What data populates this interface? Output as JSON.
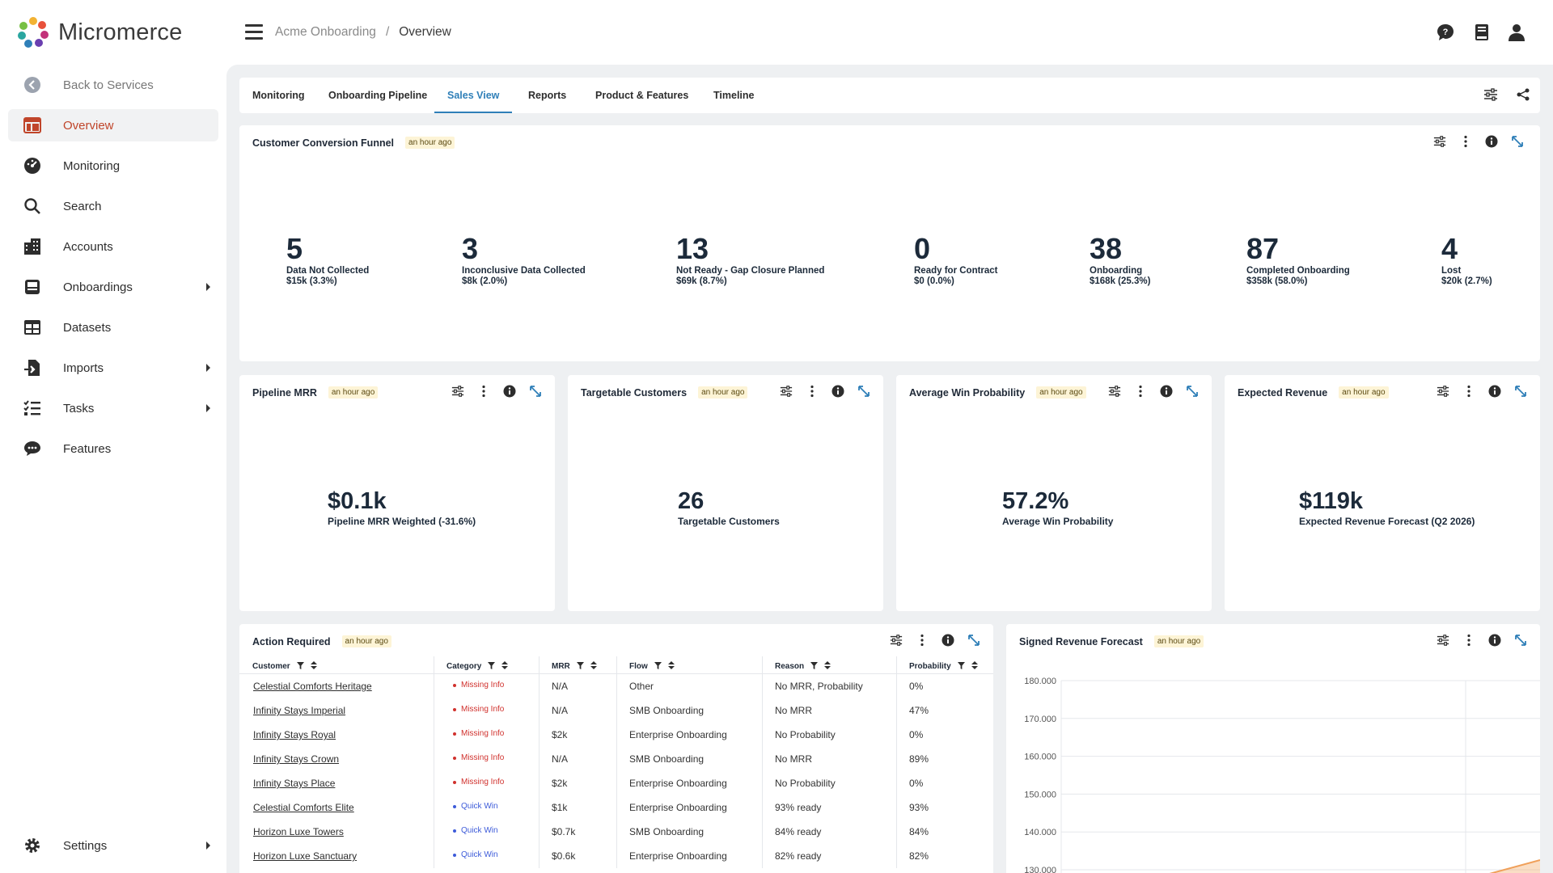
{
  "brand": {
    "name": "Micromerce"
  },
  "sidebar": {
    "items": [
      {
        "label": "Back to Services"
      },
      {
        "label": "Overview"
      },
      {
        "label": "Monitoring"
      },
      {
        "label": "Search"
      },
      {
        "label": "Accounts"
      },
      {
        "label": "Onboardings"
      },
      {
        "label": "Datasets"
      },
      {
        "label": "Imports"
      },
      {
        "label": "Tasks"
      },
      {
        "label": "Features"
      }
    ],
    "settings": {
      "label": "Settings"
    }
  },
  "breadcrumb": {
    "parent": "Acme Onboarding",
    "separator": "/",
    "current": "Overview"
  },
  "tabs": [
    {
      "label": "Monitoring"
    },
    {
      "label": "Onboarding Pipeline"
    },
    {
      "label": "Sales View"
    },
    {
      "label": "Reports"
    },
    {
      "label": "Product & Features"
    },
    {
      "label": "Timeline"
    }
  ],
  "funnel": {
    "title": "Customer Conversion Funnel",
    "badge": "an hour ago",
    "stages": [
      {
        "value": "5",
        "label": "Data Not Collected",
        "sub": "$15k (3.3%)"
      },
      {
        "value": "3",
        "label": "Inconclusive Data Collected",
        "sub": "$8k (2.0%)"
      },
      {
        "value": "13",
        "label": "Not Ready - Gap Closure Planned",
        "sub": "$69k (8.7%)"
      },
      {
        "value": "0",
        "label": "Ready for Contract",
        "sub": "$0 (0.0%)"
      },
      {
        "value": "38",
        "label": "Onboarding",
        "sub": "$168k (25.3%)"
      },
      {
        "value": "87",
        "label": "Completed Onboarding",
        "sub": "$358k (58.0%)"
      },
      {
        "value": "4",
        "label": "Lost",
        "sub": "$20k (2.7%)"
      }
    ]
  },
  "kpis": [
    {
      "title": "Pipeline MRR",
      "badge": "an hour ago",
      "value": "$0.1k",
      "label": "Pipeline MRR Weighted (-31.6%)"
    },
    {
      "title": "Targetable Customers",
      "badge": "an hour ago",
      "value": "26",
      "label": "Targetable Customers"
    },
    {
      "title": "Average Win Probability",
      "badge": "an hour ago",
      "value": "57.2%",
      "label": "Average Win Probability"
    },
    {
      "title": "Expected Revenue",
      "badge": "an hour ago",
      "value": "$119k",
      "label": "Expected Revenue Forecast (Q2 2026)"
    }
  ],
  "action": {
    "title": "Action Required",
    "badge": "an hour ago",
    "columns": [
      "Customer",
      "Category",
      "MRR",
      "Flow",
      "Reason",
      "Probability"
    ],
    "rows": [
      {
        "customer": "Celestial Comforts Heritage",
        "category": "Missing Info",
        "mrr": "N/A",
        "flow": "Other",
        "reason": "No MRR, Probability",
        "probability": "0%"
      },
      {
        "customer": "Infinity Stays Imperial",
        "category": "Missing Info",
        "mrr": "N/A",
        "flow": "SMB Onboarding",
        "reason": "No MRR",
        "probability": "47%"
      },
      {
        "customer": "Infinity Stays Royal",
        "category": "Missing Info",
        "mrr": "$2k",
        "flow": "Enterprise Onboarding",
        "reason": "No Probability",
        "probability": "0%"
      },
      {
        "customer": "Infinity Stays Crown",
        "category": "Missing Info",
        "mrr": "N/A",
        "flow": "SMB Onboarding",
        "reason": "No MRR",
        "probability": "89%"
      },
      {
        "customer": "Infinity Stays Place",
        "category": "Missing Info",
        "mrr": "$2k",
        "flow": "Enterprise Onboarding",
        "reason": "No Probability",
        "probability": "0%"
      },
      {
        "customer": "Celestial Comforts Elite",
        "category": "Quick Win",
        "mrr": "$1k",
        "flow": "Enterprise Onboarding",
        "reason": "93% ready",
        "probability": "93%"
      },
      {
        "customer": "Horizon Luxe Towers",
        "category": "Quick Win",
        "mrr": "$0.7k",
        "flow": "SMB Onboarding",
        "reason": "84% ready",
        "probability": "84%"
      },
      {
        "customer": "Horizon Luxe Sanctuary",
        "category": "Quick Win",
        "mrr": "$0.6k",
        "flow": "Enterprise Onboarding",
        "reason": "82% ready",
        "probability": "82%"
      }
    ],
    "category_colors": {
      "Missing Info": "#d0312d",
      "Quick Win": "#3d5bd9"
    }
  },
  "forecast": {
    "title": "Signed Revenue Forecast",
    "badge": "an hour ago"
  },
  "chart_data": {
    "type": "area",
    "title": "Signed Revenue Forecast",
    "ylim": [
      130000,
      180000
    ],
    "y_ticks": [
      "180.000",
      "170.000",
      "160.000",
      "150.000",
      "140.000",
      "130.000"
    ],
    "grid": true,
    "series": [
      {
        "color": "#f0a05a"
      }
    ]
  },
  "colors": {
    "accent": "#2f7fb8",
    "active_nav": "#c0452a",
    "badge_bg": "#fdf4d6",
    "content_bg": "#eef0f2"
  }
}
